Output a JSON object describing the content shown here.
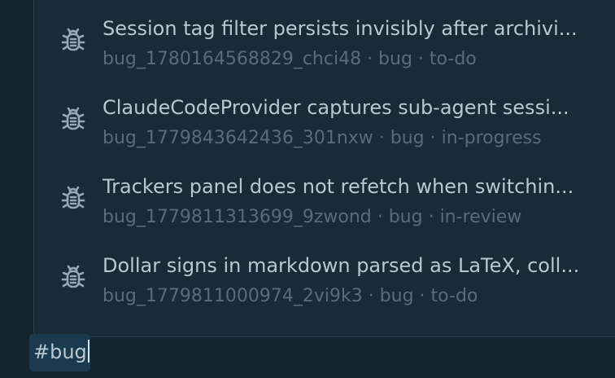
{
  "suggestions": [
    {
      "icon": "bug-icon",
      "title": "Session tag filter persists invisibly after archivi...",
      "id": "bug_1780164568829_chci48",
      "type": "bug",
      "status": "to-do",
      "meta": "bug_1780164568829_chci48 · bug · to-do"
    },
    {
      "icon": "bug-icon",
      "title": "ClaudeCodeProvider captures sub-agent sessi...",
      "id": "bug_1779843642436_301nxw",
      "type": "bug",
      "status": "in-progress",
      "meta": "bug_1779843642436_301nxw · bug · in-progress"
    },
    {
      "icon": "bug-icon",
      "title": "Trackers panel does not refetch when switchin...",
      "id": "bug_1779811313699_9zwond",
      "type": "bug",
      "status": "in-review",
      "meta": "bug_1779811313699_9zwond · bug · in-review"
    },
    {
      "icon": "bug-icon",
      "title": "Dollar signs in markdown parsed as LaTeX, coll...",
      "id": "bug_1779811000974_2vi9k3",
      "type": "bug",
      "status": "to-do",
      "meta": "bug_1779811000974_2vi9k3 · bug · to-do"
    }
  ],
  "input": {
    "value": "#bug"
  },
  "colors": {
    "background": "#14252f",
    "popup": "#172c36",
    "title_text": "#b7c8d3",
    "meta_text": "#566d7a",
    "input_highlight": "#1c3a4d"
  }
}
